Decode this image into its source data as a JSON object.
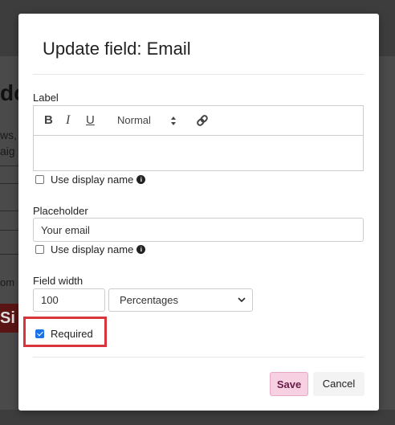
{
  "background": {
    "heading": "dc",
    "line1": "ws,",
    "line2": "aig",
    "line3": "om",
    "button": "Si"
  },
  "modal": {
    "title": "Update field: Email",
    "label_section": {
      "label": "Label",
      "toolbar": {
        "bold": "B",
        "italic": "I",
        "underline": "U",
        "size": "Normal",
        "size_arrows": "◆",
        "link_icon": "link-icon"
      },
      "value": "",
      "use_display_name": "Use display name"
    },
    "placeholder_section": {
      "label": "Placeholder",
      "value": "Your email",
      "use_display_name": "Use display name"
    },
    "width_section": {
      "label": "Field width",
      "value": "100",
      "unit": "Percentages"
    },
    "required": {
      "label": "Required",
      "checked": true
    },
    "actions": {
      "save": "Save",
      "cancel": "Cancel"
    },
    "colors": {
      "highlight": "#d9343e",
      "save_bg": "#f7d1e2",
      "save_text": "#6b1b48",
      "checkbox_accent": "#1a73e8"
    }
  }
}
